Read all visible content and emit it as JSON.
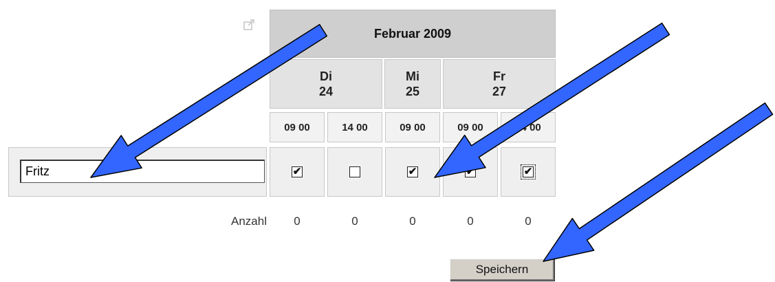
{
  "poll": {
    "month": "Februar 2009",
    "days": [
      {
        "weekday": "Di",
        "day": "24"
      },
      {
        "weekday": "Mi",
        "day": "25"
      },
      {
        "weekday": "Fr",
        "day": "27"
      }
    ],
    "times": [
      "09 00",
      "14 00",
      "09 00",
      "09 00",
      "14 00"
    ],
    "row": {
      "name_value": "Fritz",
      "checks": [
        true,
        false,
        true,
        true,
        true
      ]
    },
    "summary": {
      "label": "Anzahl",
      "counts": [
        "0",
        "0",
        "0",
        "0",
        "0"
      ]
    },
    "save_label": "Speichern"
  },
  "icons": {
    "external": "external-link-icon",
    "checkmark": "✔"
  },
  "colors": {
    "annotation_arrow_fill": "#3366ff",
    "annotation_arrow_stroke": "#000000",
    "month_header": "#cfcfcf",
    "day_header": "#e3e3e3",
    "cell_bg": "#efefef"
  }
}
